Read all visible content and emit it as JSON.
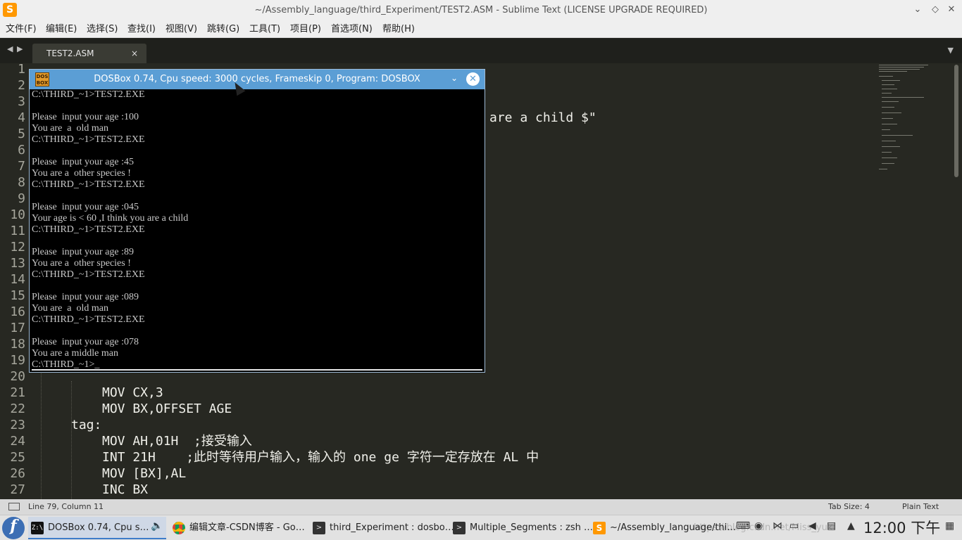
{
  "window": {
    "app_icon": "sublime-text-icon",
    "title": "~/Assembly_language/third_Experiment/TEST2.ASM - Sublime Text (LICENSE UPGRADE REQUIRED)",
    "controls": [
      "chevron-down-icon",
      "diamond-icon",
      "close-icon"
    ]
  },
  "menu": [
    "文件(F)",
    "编辑(E)",
    "选择(S)",
    "查找(I)",
    "视图(V)",
    "跳转(G)",
    "工具(T)",
    "项目(P)",
    "首选项(N)",
    "帮助(H)"
  ],
  "tabs": {
    "active": "TEST2.ASM",
    "close_glyph": "×"
  },
  "editor": {
    "line_numbers": [
      "1",
      "2",
      "3",
      "4",
      "5",
      "6",
      "7",
      "8",
      "9",
      "10",
      "11",
      "12",
      "13",
      "14",
      "15",
      "16",
      "17",
      "18",
      "19",
      "20",
      "21",
      "22",
      "23",
      "24",
      "25",
      "26",
      "27"
    ],
    "visible_fragment_line4": "are a child $\"",
    "code_lines": [
      {
        "ln": 21,
        "text": "MOV CX,3"
      },
      {
        "ln": 22,
        "text": "MOV BX,OFFSET AGE"
      },
      {
        "ln": 23,
        "text": "tag:"
      },
      {
        "ln": 24,
        "text": "MOV AH,01H  ;接受输入"
      },
      {
        "ln": 25,
        "text": "INT 21H    ;此时等待用户输入，输入的 one ge 字符一定存放在 AL 中"
      },
      {
        "ln": 26,
        "text": "MOV [BX],AL"
      },
      {
        "ln": 27,
        "text": "INC BX"
      }
    ]
  },
  "status": {
    "position": "Line 79, Column 11",
    "tab_size": "Tab Size: 4",
    "syntax": "Plain Text"
  },
  "dosbox": {
    "title": "DOSBox 0.74, Cpu speed: 3000 cycles, Frameskip 0, Program: DOSBOX",
    "logo_text": "DOS BOX",
    "lines": [
      "C:\\THIRD_~1>TEST2.EXE",
      "",
      "Please  input your age :100",
      "You are  a  old man",
      "C:\\THIRD_~1>TEST2.EXE",
      "",
      "Please  input your age :45",
      "You are a  other species !",
      "C:\\THIRD_~1>TEST2.EXE",
      "",
      "Please  input your age :045",
      "Your age is < 60 ,I think you are a child",
      "C:\\THIRD_~1>TEST2.EXE",
      "",
      "Please  input your age :89",
      "You are a  other species !",
      "C:\\THIRD_~1>TEST2.EXE",
      "",
      "Please  input your age :089",
      "You are  a  old man",
      "C:\\THIRD_~1>TEST2.EXE",
      "",
      "Please  input your age :078",
      "You are a middle man",
      "C:\\THIRD_~1>_"
    ]
  },
  "taskbar": {
    "start_icon": "fedora-icon",
    "tasks": [
      {
        "label": "DOSBox 0.74, Cpu s…",
        "icon": "dosbox-icon",
        "active": true
      },
      {
        "label": "编辑文章-CSDN博客 - Go…",
        "icon": "chrome-icon",
        "active": false
      },
      {
        "label": "third_Experiment : dosbo…",
        "icon": "terminal-icon",
        "active": false
      },
      {
        "label": "Multiple_Segments : zsh …",
        "icon": "terminal-icon",
        "active": false
      },
      {
        "label": "~/Assembly_language/thi…",
        "icon": "sublime-text-icon",
        "active": false
      }
    ],
    "watermark": "https://blog.csdn.net/Miss_yuki",
    "clock": "12:00 下午"
  }
}
